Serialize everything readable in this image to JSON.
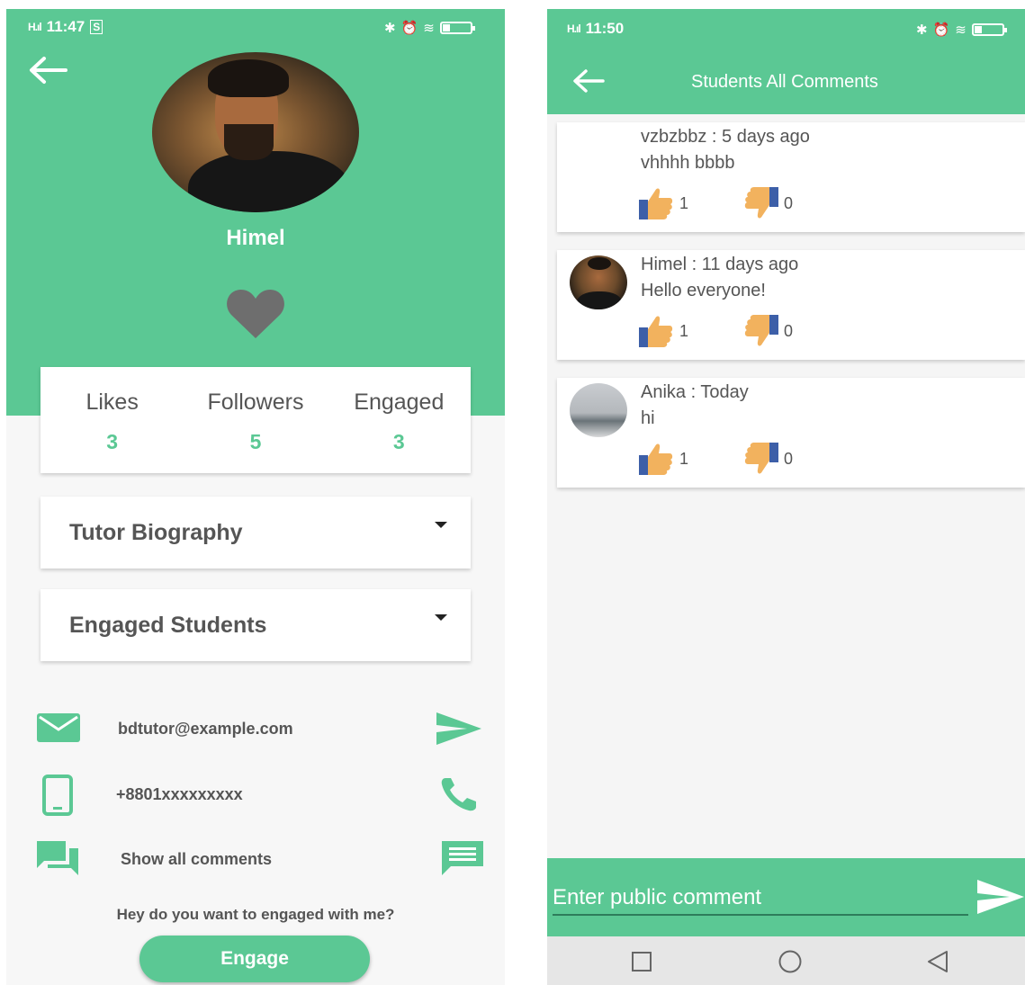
{
  "left": {
    "status_time": "11:47",
    "profile_name": "Himel",
    "stats": [
      {
        "label": "Likes",
        "value": "3"
      },
      {
        "label": "Followers",
        "value": "5"
      },
      {
        "label": "Engaged",
        "value": "3"
      }
    ],
    "dropdowns": {
      "biography": "Tutor Biography",
      "engaged_students": "Engaged Students"
    },
    "email": "bdtutor@example.com",
    "phone": "+8801xxxxxxxxx",
    "show_comments": "Show all comments",
    "question": "Hey do you want to engaged with me?",
    "engage_label": "Engage",
    "accent": "#5bc894"
  },
  "right": {
    "status_time": "11:50",
    "title": "Students All Comments",
    "comments": [
      {
        "author": "vzbzbbz",
        "when": "5 days ago",
        "header": "vzbzbbz : 5 days ago",
        "text": "vhhhh bbbb",
        "likes": "1",
        "dislikes": "0"
      },
      {
        "author": "Himel",
        "when": "11 days ago",
        "header": "Himel : 11 days ago",
        "text": "Hello everyone!",
        "likes": "1",
        "dislikes": "0"
      },
      {
        "author": "Anika",
        "when": "Today",
        "header": "Anika : Today",
        "text": "hi",
        "likes": "1",
        "dislikes": "0"
      }
    ],
    "comment_placeholder": "Enter public comment"
  }
}
